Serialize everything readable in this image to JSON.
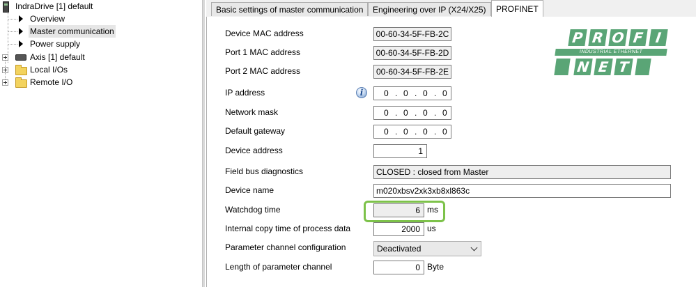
{
  "tree": {
    "items": [
      {
        "label": "IndraDrive [1] default"
      },
      {
        "label": "Overview"
      },
      {
        "label": "Master communication"
      },
      {
        "label": "Power supply"
      },
      {
        "label": "Axis [1] default"
      },
      {
        "label": "Local I/Os"
      },
      {
        "label": "Remote I/O"
      }
    ]
  },
  "tabs": [
    {
      "label": "Basic settings of master communication"
    },
    {
      "label": "Engineering over IP (X24/X25)"
    },
    {
      "label": "PROFINET"
    }
  ],
  "logo": {
    "top": [
      "P",
      "R",
      "O",
      "F",
      "I"
    ],
    "band": "INDUSTRIAL ETHERNET",
    "bottom": [
      "N",
      "E",
      "T"
    ],
    "color": "#5aa576"
  },
  "form": {
    "device_mac": {
      "label": "Device MAC address",
      "value": "00-60-34-5F-FB-2C"
    },
    "port1_mac": {
      "label": "Port 1 MAC address",
      "value": "00-60-34-5F-FB-2D"
    },
    "port2_mac": {
      "label": "Port 2 MAC address",
      "value": "00-60-34-5F-FB-2E"
    },
    "ip": {
      "label": "IP address",
      "octets": [
        "0",
        "0",
        "0",
        "0"
      ],
      "sep": "."
    },
    "mask": {
      "label": "Network mask",
      "octets": [
        "0",
        "0",
        "0",
        "0"
      ],
      "sep": "."
    },
    "gateway": {
      "label": "Default gateway",
      "octets": [
        "0",
        "0",
        "0",
        "0"
      ],
      "sep": "."
    },
    "device_address": {
      "label": "Device address",
      "value": "1"
    },
    "diag": {
      "label": "Field bus diagnostics",
      "value": "CLOSED : closed from Master"
    },
    "device_name": {
      "label": "Device name",
      "value": "m020xbsv2xk3xb8xl863c"
    },
    "watchdog": {
      "label": "Watchdog time",
      "value": "6",
      "unit": "ms"
    },
    "copy_time": {
      "label": "Internal copy time of process data",
      "value": "2000",
      "unit": "us"
    },
    "param_config": {
      "label": "Parameter channel configuration",
      "value": "Deactivated"
    },
    "param_length": {
      "label": "Length of parameter channel",
      "value": "0",
      "unit": "Byte"
    }
  },
  "colors": {
    "highlight": "#7dc24a",
    "selected": "#e6e6e6"
  }
}
